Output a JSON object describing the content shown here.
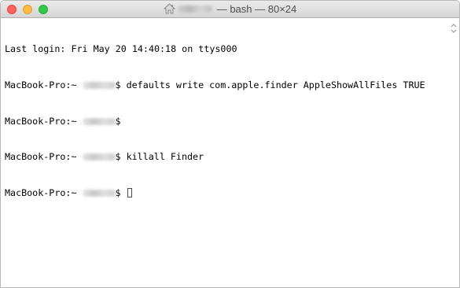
{
  "window": {
    "title_suffix": "— bash — 80×24"
  },
  "terminal": {
    "last_login": "Last login: Fri May 20 14:40:18 on ttys000",
    "prompt_host": "MacBook-Pro:~ ",
    "prompt_symbol": "$ ",
    "commands": [
      "defaults write com.apple.finder AppleShowAllFiles TRUE",
      "",
      "killall Finder",
      ""
    ]
  },
  "icons": {
    "title_icon": "home-icon",
    "cursor": "block-cursor"
  },
  "colors": {
    "close": "#fc615d",
    "minimize": "#fdbc40",
    "zoom": "#34c84a",
    "text": "#000000",
    "background": "#ffffff"
  }
}
